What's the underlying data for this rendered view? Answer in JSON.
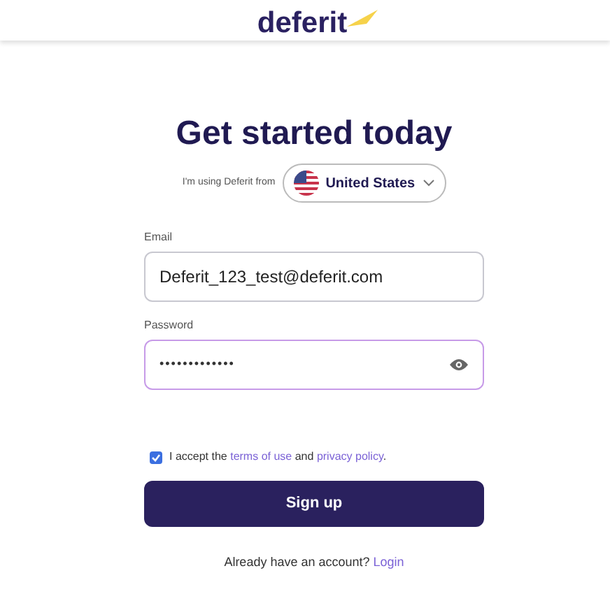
{
  "header": {
    "logo": "deferit"
  },
  "title": "Get started today",
  "country": {
    "label": "I'm using Deferit from",
    "value": "United States"
  },
  "email": {
    "label": "Email",
    "value": "Deferit_123_test@deferit.com",
    "focused": false
  },
  "password": {
    "label": "Password",
    "value": "•••••••••••••",
    "focused": true
  },
  "terms": {
    "checked": true,
    "parts": [
      "I accept the",
      "terms of use",
      "and",
      "privacy policy",
      "."
    ]
  },
  "signup_button": "Sign up",
  "login": {
    "question": "Already have an account?",
    "link": "Login"
  }
}
